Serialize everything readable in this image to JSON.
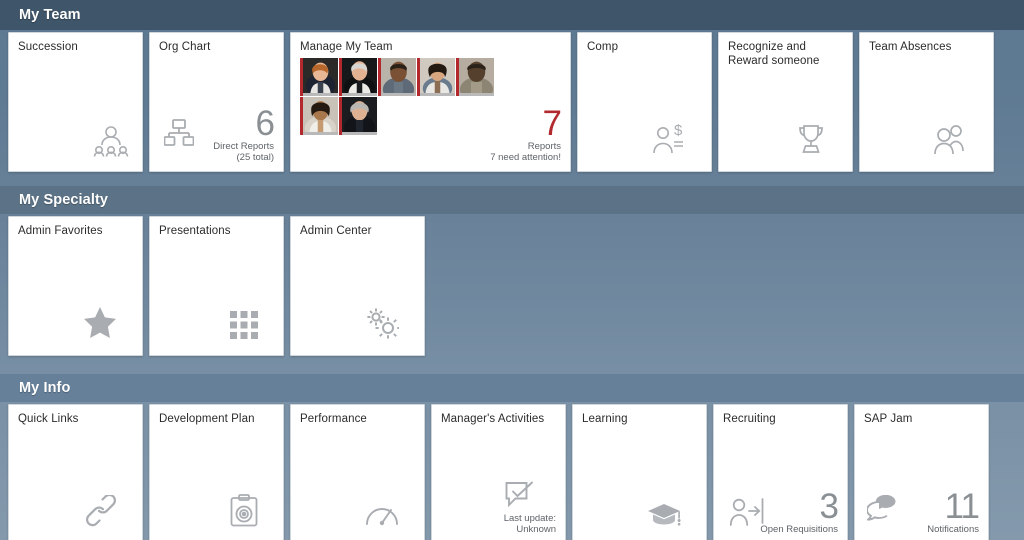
{
  "sections": [
    {
      "id": "my-team",
      "title": "My Team",
      "tiles": [
        {
          "name": "succession",
          "title": "Succession",
          "icon": "person-group-succession-icon"
        },
        {
          "name": "org-chart",
          "title": "Org Chart",
          "icon": "org-chart-icon",
          "kpi_number": "6",
          "kpi_caption": "Direct Reports\n(25 total)"
        },
        {
          "name": "manage-my-team",
          "title": "Manage My Team",
          "wide": true,
          "kpi_number": "7",
          "kpi_caption": "Reports\n7 need attention!",
          "kpi_red": true,
          "avatars": 7
        },
        {
          "name": "comp",
          "title": "Comp",
          "icon": "person-dollar-icon"
        },
        {
          "name": "recognize-reward",
          "title": "Recognize and\nReward someone",
          "icon": "trophy-icon"
        },
        {
          "name": "team-absences",
          "title": "Team Absences",
          "icon": "two-people-icon"
        }
      ]
    },
    {
      "id": "my-specialty",
      "title": "My Specialty",
      "tiles": [
        {
          "name": "admin-favorites",
          "title": "Admin Favorites",
          "icon": "star-icon"
        },
        {
          "name": "presentations",
          "title": "Presentations",
          "icon": "grid-tiles-icon"
        },
        {
          "name": "admin-center",
          "title": "Admin Center",
          "icon": "gears-icon"
        }
      ]
    },
    {
      "id": "my-info",
      "title": "My Info",
      "tiles": [
        {
          "name": "quick-links",
          "title": "Quick Links",
          "icon": "link-chain-icon"
        },
        {
          "name": "development-plan",
          "title": "Development Plan",
          "icon": "clipboard-target-icon"
        },
        {
          "name": "performance",
          "title": "Performance",
          "icon": "speedometer-icon"
        },
        {
          "name": "managers-activities",
          "title": "Manager's Activities",
          "icon": "checked-speech-bubble-icon",
          "caption": "Last update:\nUnknown"
        },
        {
          "name": "learning",
          "title": "Learning",
          "icon": "graduation-cap-icon"
        },
        {
          "name": "recruiting",
          "title": "Recruiting",
          "icon": "person-arrow-door-icon",
          "kpi_number": "3",
          "kpi_caption": "Open Requisitions",
          "icon_left": true
        },
        {
          "name": "sap-jam",
          "title": "SAP Jam",
          "icon": "chat-bubbles-icon",
          "kpi_number": "11",
          "kpi_caption": "Notifications",
          "icon_left": true
        }
      ]
    }
  ],
  "colors": {
    "background_top": "#5d7891",
    "background_bottom": "#8499ac",
    "tile_background": "#ffffff",
    "header_team": "#3f5569",
    "accent_red": "#b02a2f",
    "icon_gray": "#a9adb1",
    "kpi_gray": "#8a8f94"
  }
}
